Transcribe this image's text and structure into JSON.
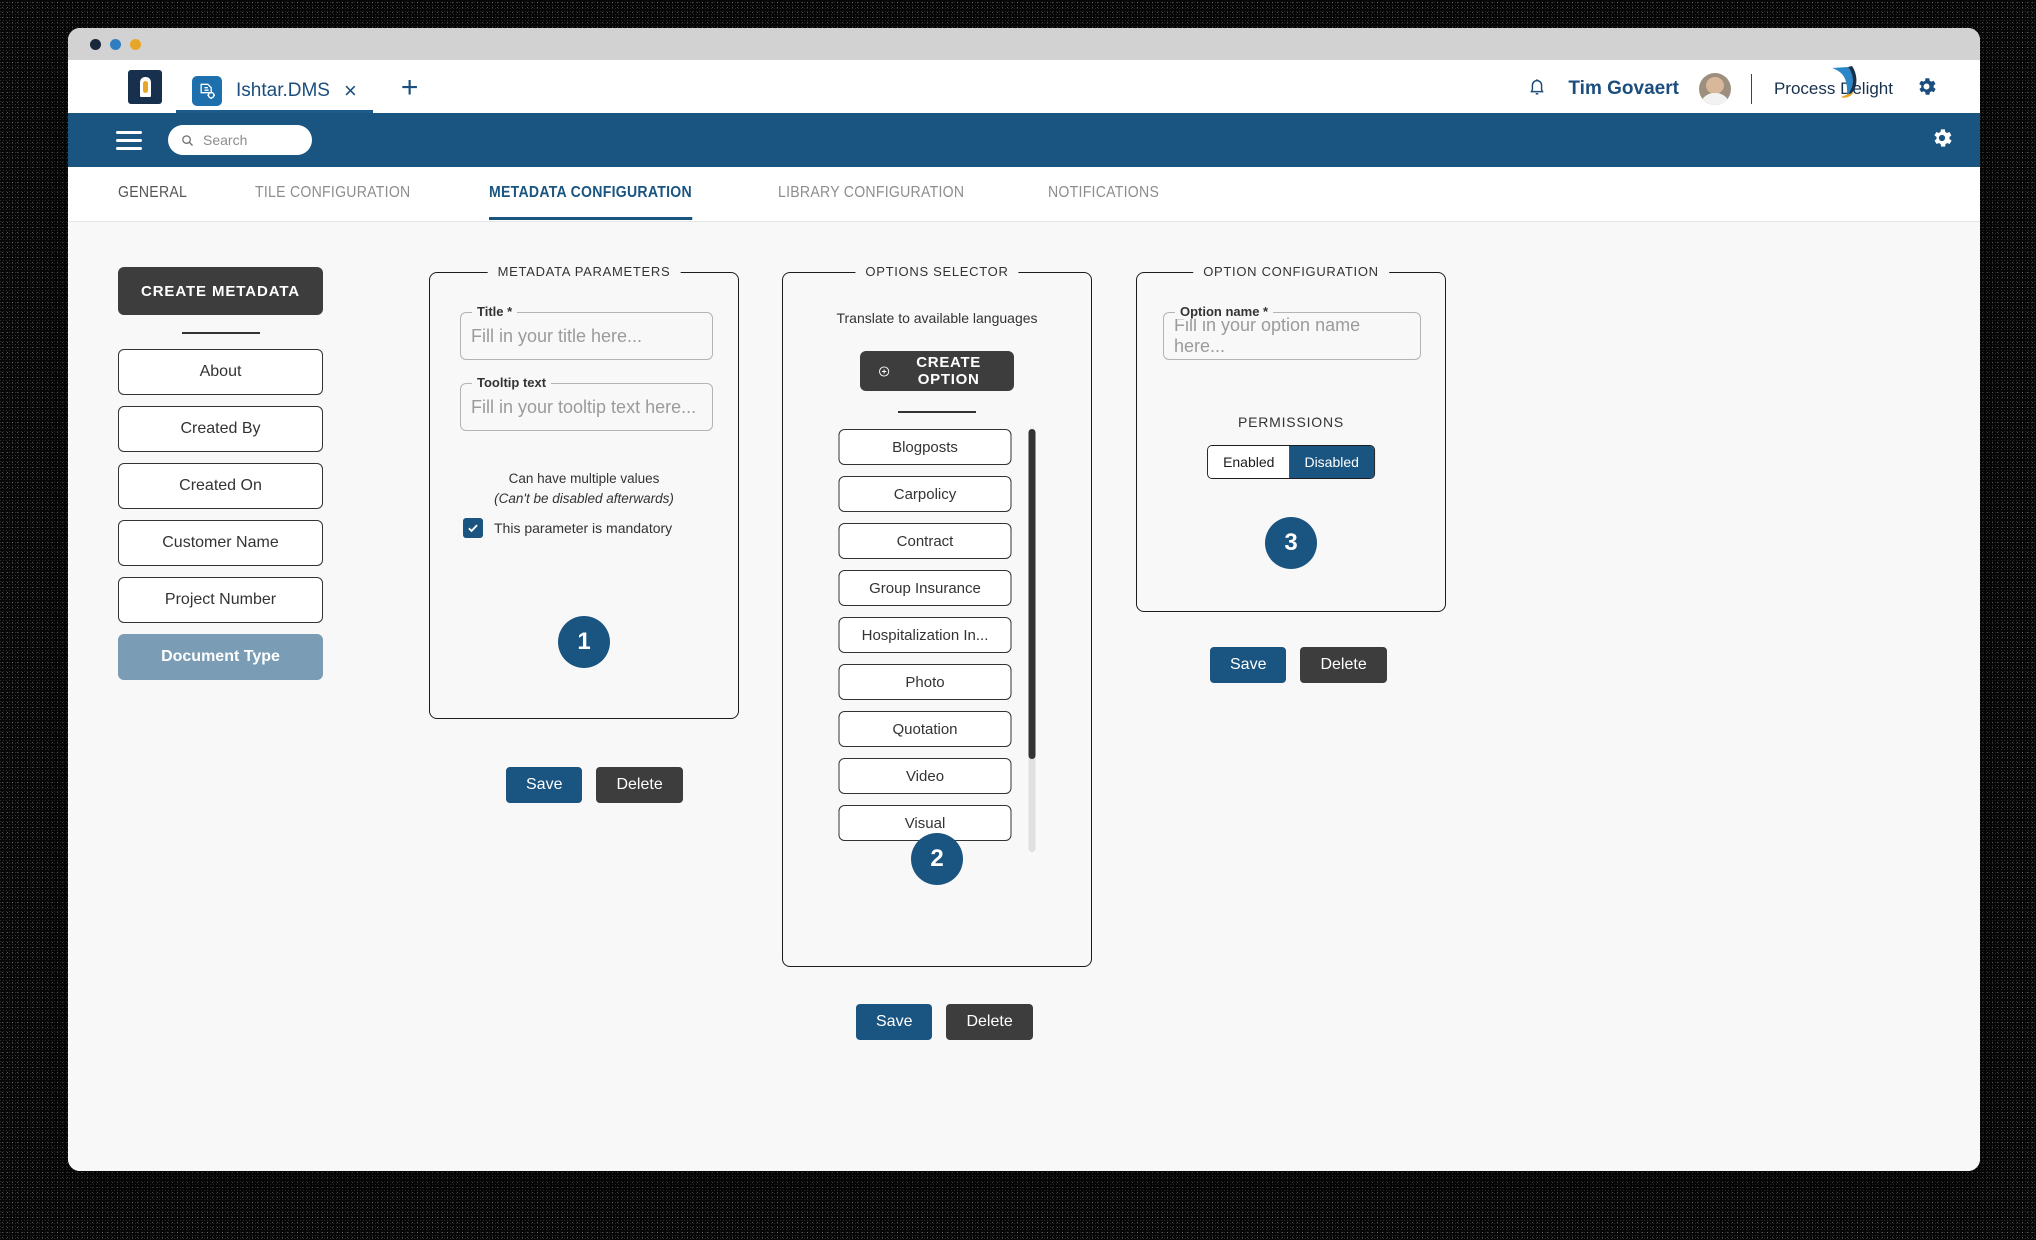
{
  "browser": {
    "traffic_lights": [
      "close",
      "minimize",
      "maximize"
    ],
    "app_icon": "ishtar-logo-icon",
    "tab": {
      "favicon": "document-gear-icon",
      "title": "Ishtar.DMS",
      "close": "×",
      "new_tab": "+"
    },
    "notifications_icon": "bell-icon",
    "user_name": "Tim Govaert",
    "avatar": "user-avatar",
    "brand": "Process Delight",
    "settings_icon": "gear-icon"
  },
  "appbar": {
    "menu_icon": "hamburger-menu-icon",
    "search_icon": "search-icon",
    "search_placeholder": "Search",
    "search_value": "",
    "settings_icon": "gear-icon"
  },
  "subnav": {
    "items": [
      {
        "label": "GENERAL",
        "active": false
      },
      {
        "label": "TILE CONFIGURATION",
        "active": false
      },
      {
        "label": "METADATA CONFIGURATION",
        "active": true
      },
      {
        "label": "LIBRARY CONFIGURATION",
        "active": false
      },
      {
        "label": "NOTIFICATIONS",
        "active": false
      }
    ]
  },
  "sidebar": {
    "create_button": "CREATE METADATA",
    "items": [
      {
        "label": "About",
        "selected": false
      },
      {
        "label": "Created By",
        "selected": false
      },
      {
        "label": "Created On",
        "selected": false
      },
      {
        "label": "Customer Name",
        "selected": false
      },
      {
        "label": "Project Number",
        "selected": false
      },
      {
        "label": "Document Type",
        "selected": true
      }
    ]
  },
  "metadata_panel": {
    "legend": "METADATA PARAMETERS",
    "title_field": {
      "label": "Title *",
      "placeholder": "Fill in your title here...",
      "value": ""
    },
    "tooltip_field": {
      "label": "Tooltip text",
      "placeholder": "Fill in your tooltip text here...",
      "value": ""
    },
    "helper_line1": "Can have multiple values",
    "helper_line2": "(Can't be disabled afterwards)",
    "checkbox_label": "This parameter is mandatory",
    "checkbox_checked": true,
    "badge": "1",
    "save_label": "Save",
    "delete_label": "Delete"
  },
  "options_panel": {
    "legend": "OPTIONS SELECTOR",
    "translate_hint": "Translate to available languages",
    "create_option_label": "CREATE OPTION",
    "create_option_icon": "plus-circle-icon",
    "options": [
      "Blogposts",
      "Carpolicy",
      "Contract",
      "Group Insurance",
      "Hospitalization In...",
      "Photo",
      "Quotation",
      "Video",
      "Visual"
    ],
    "badge": "2",
    "save_label": "Save",
    "delete_label": "Delete"
  },
  "option_config_panel": {
    "legend": "OPTION CONFIGURATION",
    "name_field": {
      "label": "Option name *",
      "placeholder": "Fill in your option name here...",
      "value": ""
    },
    "permissions_title": "PERMISSIONS",
    "toggle": {
      "enabled_label": "Enabled",
      "disabled_label": "Disabled",
      "selected": "Disabled"
    },
    "badge": "3",
    "save_label": "Save",
    "delete_label": "Delete"
  },
  "colors": {
    "accent_blue": "#1a5480",
    "dark_button": "#3d3d3d",
    "selected_item": "#7a9cb5",
    "content_bg": "#f8f8f8"
  }
}
